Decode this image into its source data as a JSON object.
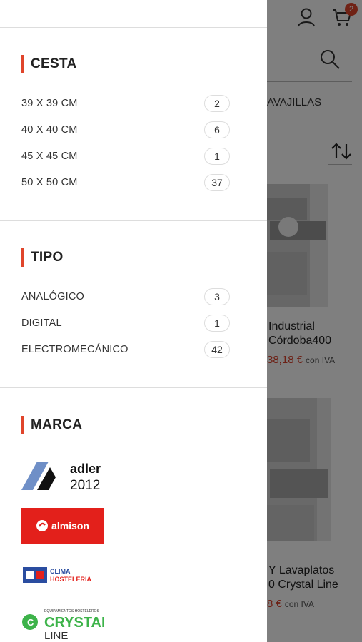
{
  "header": {
    "cart_count": "2"
  },
  "background": {
    "category_label": "AVAJILLAS",
    "products": [
      {
        "title_line1": "Industrial",
        "title_line2": "Córdoba400",
        "price": "38,18 €",
        "tax": "con IVA"
      },
      {
        "title_line1": "Y Lavaplatos",
        "title_line2": "0 Crystal Line",
        "price": "8 €",
        "tax": "con IVA"
      }
    ]
  },
  "filters": {
    "cesta": {
      "title": "CESTA",
      "options": [
        {
          "label": "39 X 39 CM",
          "count": "2"
        },
        {
          "label": "40 X 40 CM",
          "count": "6"
        },
        {
          "label": "45 X 45 CM",
          "count": "1"
        },
        {
          "label": "50 X 50 CM",
          "count": "37"
        }
      ]
    },
    "tipo": {
      "title": "TIPO",
      "options": [
        {
          "label": "ANALÓGICO",
          "count": "3"
        },
        {
          "label": "DIGITAL",
          "count": "1"
        },
        {
          "label": "ELECTROMECÁNICO",
          "count": "42"
        }
      ]
    },
    "marca": {
      "title": "MARCA",
      "brands": [
        {
          "name": "adler",
          "sub": "2012"
        },
        {
          "name": "almison"
        },
        {
          "name": "CLIMA",
          "sub": "HOSTELERIA"
        },
        {
          "name": "CRYSTAL",
          "sub": "LINE",
          "top": "EQUIPAMIENTOS HOSTELEROS"
        }
      ]
    }
  },
  "colors": {
    "accent": "#e0452b",
    "brand_red": "#e3201b"
  }
}
